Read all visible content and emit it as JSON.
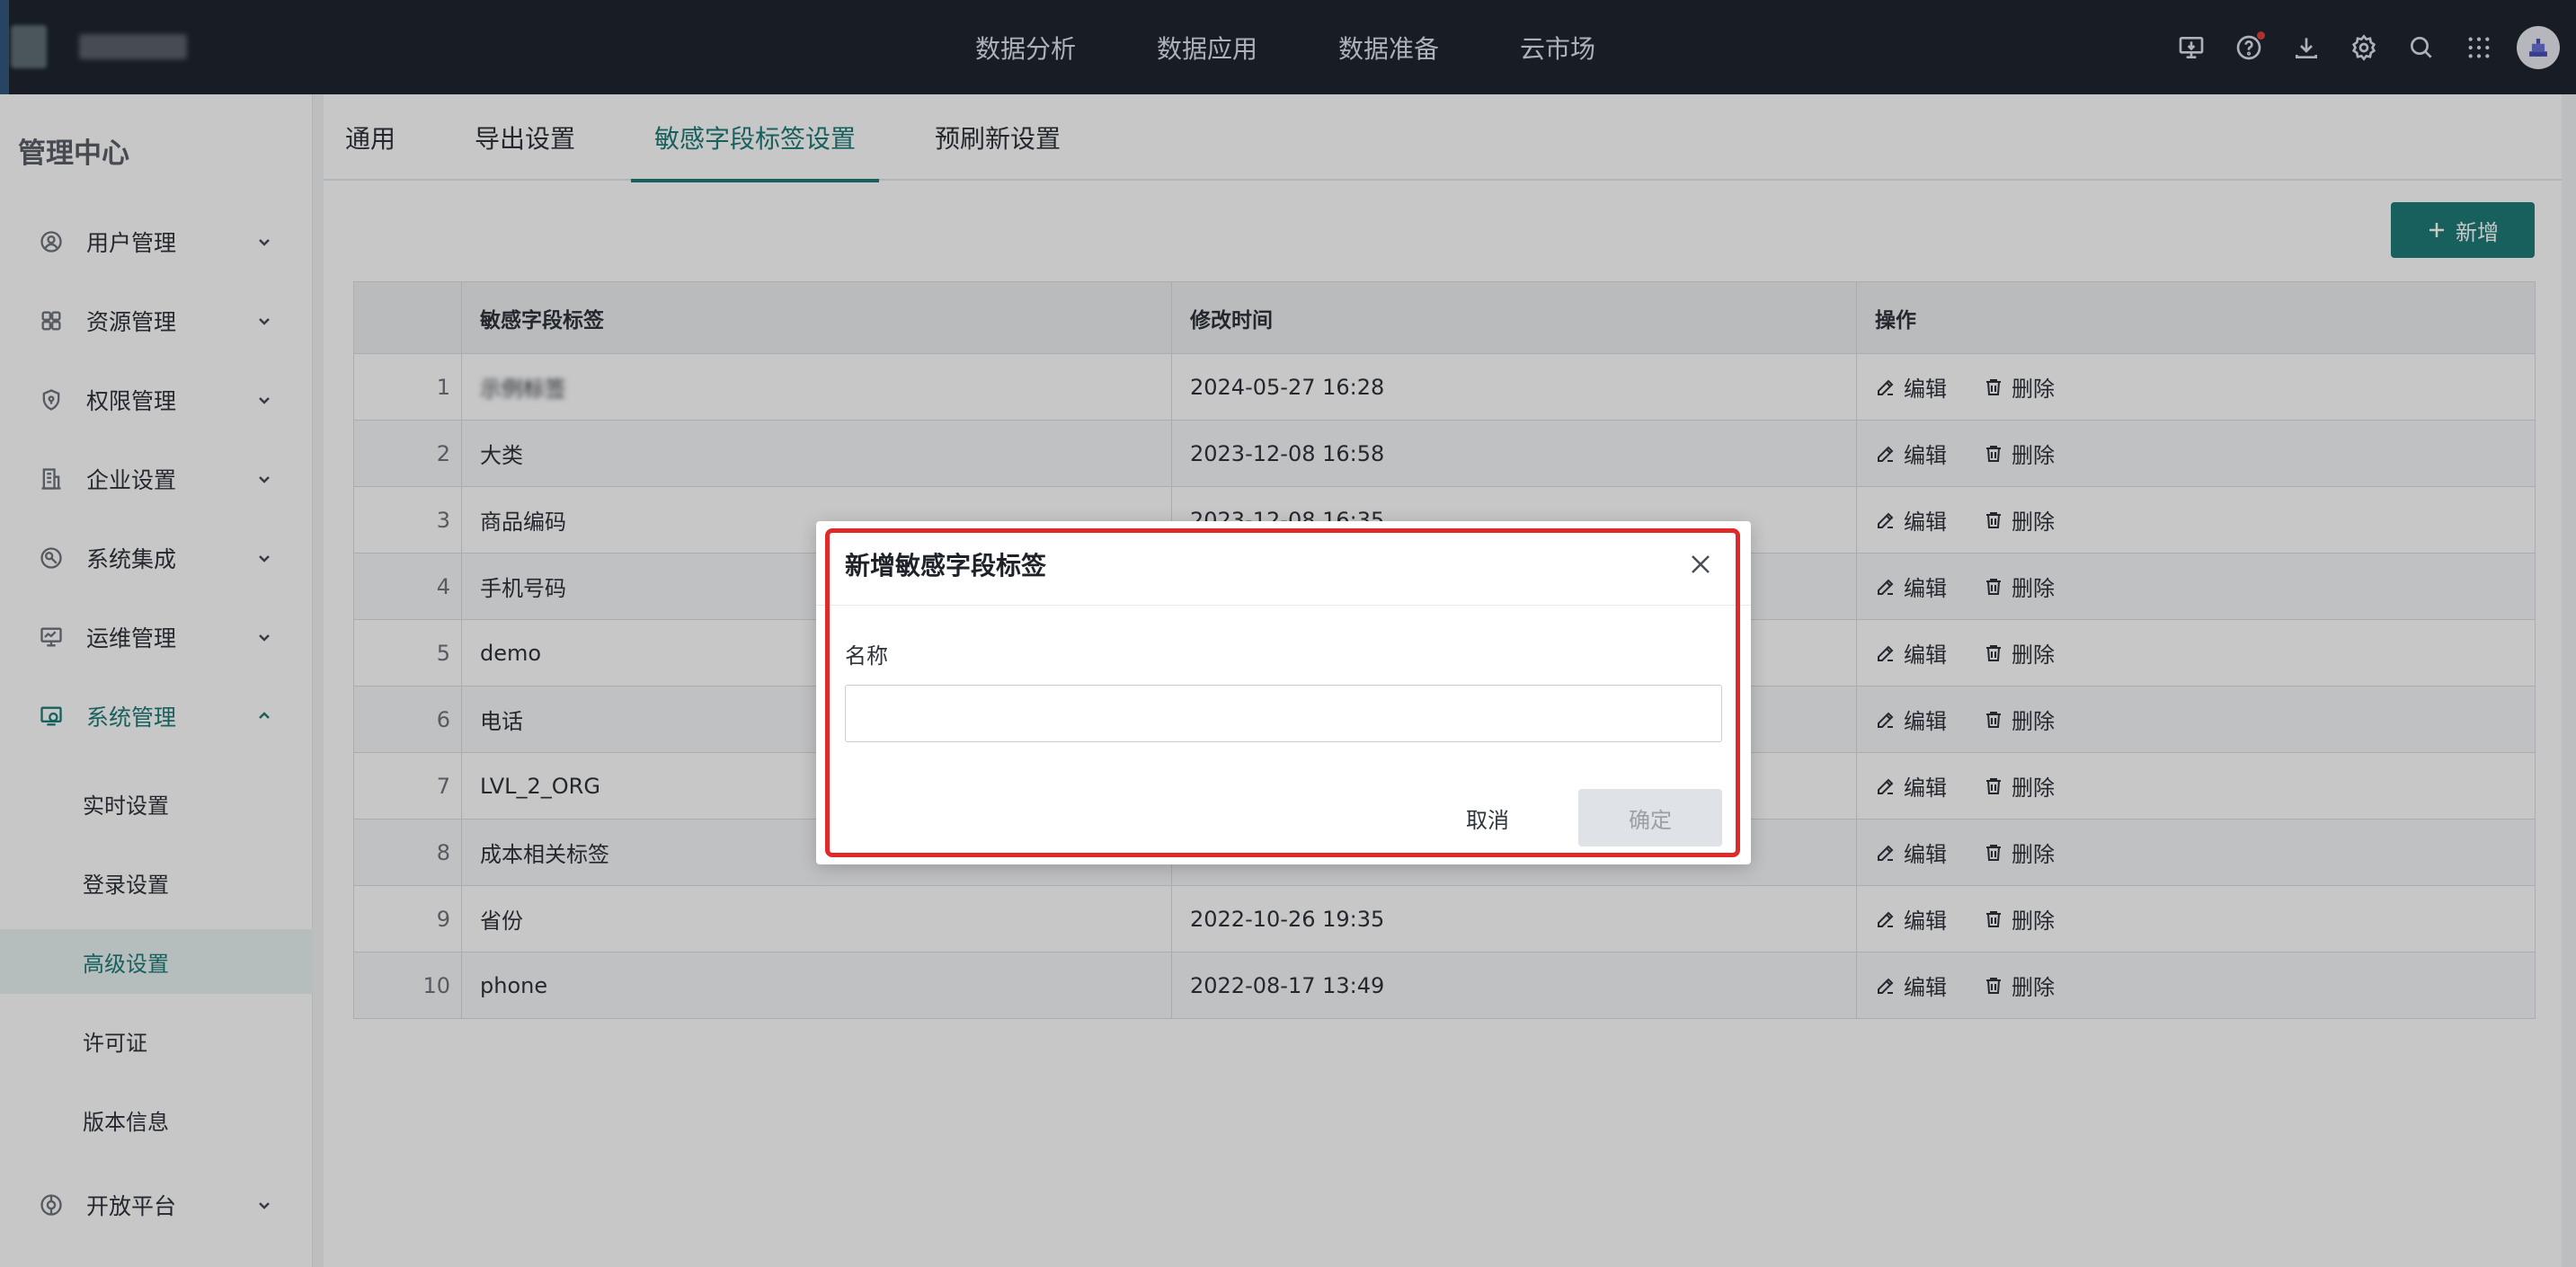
{
  "topbar": {
    "nav": [
      "数据分析",
      "数据应用",
      "数据准备",
      "云市场"
    ],
    "icons": [
      "monitor-download-icon",
      "help-icon",
      "download-icon",
      "settings-icon",
      "search-icon",
      "apps-grid-icon"
    ],
    "notification_dot_color": "#e0403a"
  },
  "sidebar": {
    "title": "管理中心",
    "items": [
      {
        "label": "用户管理",
        "icon": "user-icon"
      },
      {
        "label": "资源管理",
        "icon": "resource-icon"
      },
      {
        "label": "权限管理",
        "icon": "shield-icon"
      },
      {
        "label": "企业设置",
        "icon": "building-icon"
      },
      {
        "label": "系统集成",
        "icon": "integration-icon"
      },
      {
        "label": "运维管理",
        "icon": "monitor-icon"
      },
      {
        "label": "系统管理",
        "icon": "system-gear-icon"
      }
    ],
    "sub_items": [
      "实时设置",
      "登录设置",
      "高级设置",
      "许可证",
      "版本信息"
    ],
    "last_item": {
      "label": "开放平台",
      "icon": "open-platform-icon"
    }
  },
  "tabs": [
    "通用",
    "导出设置",
    "敏感字段标签设置",
    "预刷新设置"
  ],
  "add_button": "新增",
  "table": {
    "headers": [
      "",
      "敏感字段标签",
      "修改时间",
      "操作"
    ],
    "rows": [
      {
        "idx": "1",
        "label": "示例标签",
        "time": "2024-05-27 16:28"
      },
      {
        "idx": "2",
        "label": "大类",
        "time": "2023-12-08 16:58"
      },
      {
        "idx": "3",
        "label": "商品编码",
        "time": "2023-12-08 16:35"
      },
      {
        "idx": "4",
        "label": "手机号码",
        "time": ""
      },
      {
        "idx": "5",
        "label": "demo",
        "time": ""
      },
      {
        "idx": "6",
        "label": "电话",
        "time": ""
      },
      {
        "idx": "7",
        "label": "LVL_2_ORG",
        "time": ""
      },
      {
        "idx": "8",
        "label": "成本相关标签",
        "time": ""
      },
      {
        "idx": "9",
        "label": "省份",
        "time": "2022-10-26 19:35"
      },
      {
        "idx": "10",
        "label": "phone",
        "time": "2022-08-17 13:49"
      }
    ],
    "edit_label": "编辑",
    "delete_label": "删除"
  },
  "modal": {
    "title": "新增敏感字段标签",
    "field_label": "名称",
    "field_value": "",
    "cancel": "取消",
    "confirm": "确定"
  },
  "colors": {
    "accent": "#1e7b78",
    "topbar": "#1e2530",
    "highlight_frame": "#e02a2a"
  }
}
